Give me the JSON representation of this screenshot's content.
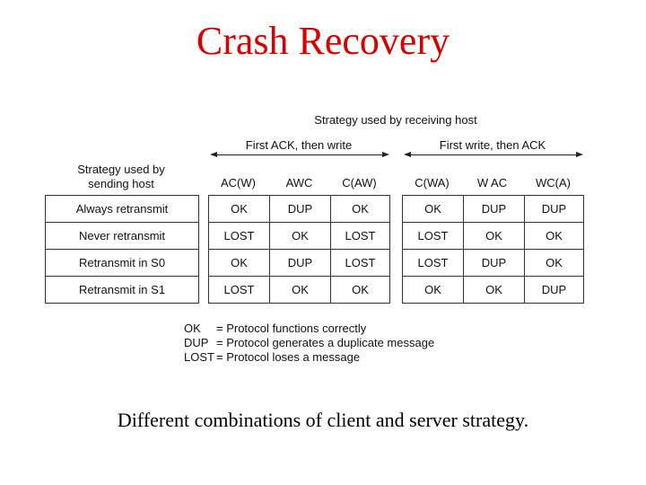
{
  "title": "Crash Recovery",
  "receiving_strategy_label": "Strategy used by receiving host",
  "groups": [
    {
      "label": "First ACK, then write",
      "columns": [
        "AC(W)",
        "AWC",
        "C(AW)"
      ]
    },
    {
      "label": "First  write, then ACK",
      "columns": [
        "C(WA)",
        "W AC",
        "WC(A)"
      ]
    }
  ],
  "sending_strategy_label_line1": "Strategy used by",
  "sending_strategy_label_line2": "sending host",
  "rows": [
    {
      "label": "Always retransmit",
      "group1": [
        "OK",
        "DUP",
        "OK"
      ],
      "group2": [
        "OK",
        "DUP",
        "DUP"
      ]
    },
    {
      "label": "Never retransmit",
      "group1": [
        "LOST",
        "OK",
        "LOST"
      ],
      "group2": [
        "LOST",
        "OK",
        "OK"
      ]
    },
    {
      "label": "Retransmit in S0",
      "group1": [
        "OK",
        "DUP",
        "LOST"
      ],
      "group2": [
        "LOST",
        "DUP",
        "OK"
      ]
    },
    {
      "label": "Retransmit in S1",
      "group1": [
        "LOST",
        "OK",
        "OK"
      ],
      "group2": [
        "OK",
        "OK",
        "DUP"
      ]
    }
  ],
  "legend": [
    {
      "key": "OK",
      "desc": "= Protocol functions correctly"
    },
    {
      "key": "DUP",
      "desc": "= Protocol generates a duplicate message"
    },
    {
      "key": "LOST",
      "desc": "= Protocol loses a message"
    }
  ],
  "caption": "Different combinations of client and server strategy.",
  "colors": {
    "title": "#d40000",
    "text": "#111111",
    "background": "#ffffff"
  }
}
